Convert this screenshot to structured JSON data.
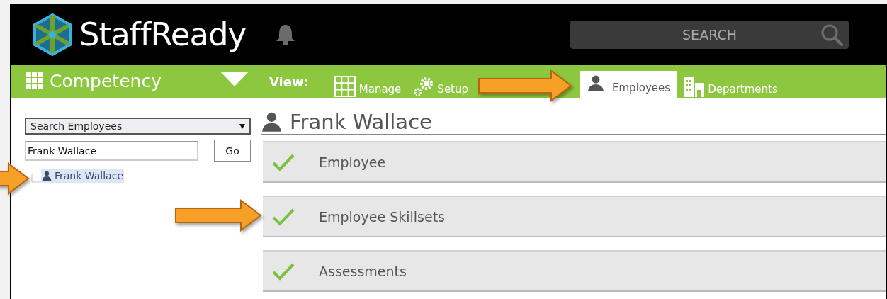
{
  "header": {
    "app_name": "StaffReady",
    "search": {
      "placeholder": "SEARCH"
    }
  },
  "navbar": {
    "module": "Competency",
    "view_label": "View:",
    "tabs": [
      {
        "kind": "grid",
        "label": "Manage",
        "selected": false
      },
      {
        "kind": "gears",
        "label": "Setup",
        "selected": false
      },
      {
        "kind": "person",
        "label": "Employees",
        "selected": true
      },
      {
        "kind": "building",
        "label": "Departments",
        "selected": false
      }
    ]
  },
  "sidebar": {
    "search_type": "Search Employees",
    "search_value": "Frank Wallace",
    "go_button": "Go",
    "tree": [
      {
        "label": "Frank Wallace",
        "selected": true
      }
    ]
  },
  "main": {
    "title": "Frank Wallace",
    "sections": [
      {
        "label": "Employee",
        "checked": true
      },
      {
        "label": "Employee Skillsets",
        "checked": true
      },
      {
        "label": "Assessments",
        "checked": true
      }
    ]
  },
  "annotations": [
    {
      "kind": "arrow"
    },
    {
      "kind": "arrow"
    },
    {
      "kind": "arrow"
    }
  ]
}
